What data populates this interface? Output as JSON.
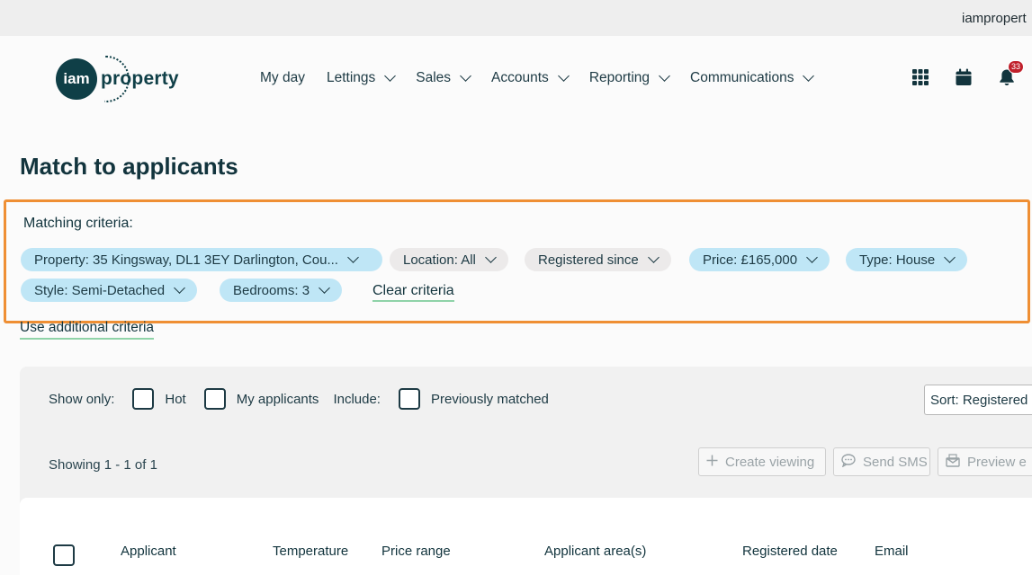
{
  "topbar": {
    "user_name": "iampropert"
  },
  "logo": {
    "badge": "iam",
    "word": "property"
  },
  "nav": {
    "items": [
      {
        "label": "My day",
        "has_dropdown": false
      },
      {
        "label": "Lettings",
        "has_dropdown": true
      },
      {
        "label": "Sales",
        "has_dropdown": true
      },
      {
        "label": "Accounts",
        "has_dropdown": true
      },
      {
        "label": "Reporting",
        "has_dropdown": true
      },
      {
        "label": "Communications",
        "has_dropdown": true
      }
    ],
    "icons": [
      "apps-grid-icon",
      "calendar-icon",
      "bell-icon"
    ],
    "notification_count": "33"
  },
  "page": {
    "title": "Match to applicants"
  },
  "criteria": {
    "label": "Matching criteria:",
    "chips": [
      {
        "label": "Property: 35 Kingsway, DL1 3EY Darlington, Cou...",
        "active": true
      },
      {
        "label": "Location: All",
        "active": false
      },
      {
        "label": "Registered since",
        "active": false
      },
      {
        "label": "Price: £165,000",
        "active": true
      },
      {
        "label": "Type: House",
        "active": true
      },
      {
        "label": "Style: Semi-Detached",
        "active": true
      },
      {
        "label": "Bedrooms: 3",
        "active": true
      }
    ],
    "clear_label": "Clear criteria"
  },
  "additional_label": "Use additional criteria",
  "filters": {
    "show_only_label": "Show only:",
    "hot_label": "Hot",
    "my_applicants_label": "My applicants",
    "include_label": "Include:",
    "previously_matched_label": "Previously matched"
  },
  "sort": {
    "label": "Sort: Registered"
  },
  "results": {
    "showing": "Showing 1 - 1 of 1"
  },
  "actions": {
    "create_viewing": "Create viewing",
    "send_sms": "Send SMS",
    "preview_email": "Preview e"
  },
  "table": {
    "columns": [
      "Applicant",
      "Temperature",
      "Price range",
      "Applicant area(s)",
      "Registered date",
      "Email"
    ]
  },
  "colors": {
    "accent_border": "#ef8f34",
    "chip_active": "#bfe6f6",
    "chip_inactive": "#eceaea",
    "link_underline": "#8fd3a8",
    "brand": "#0f3f47",
    "badge": "#c0202b"
  }
}
